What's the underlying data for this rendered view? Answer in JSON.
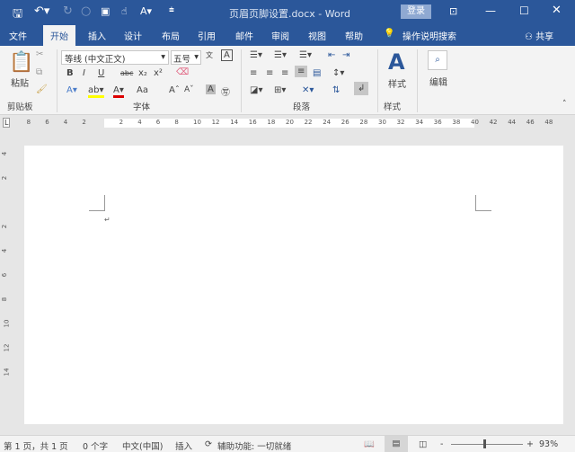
{
  "title_bar": {
    "document_title": "页眉页脚设置.docx - Word",
    "login_label": "登录"
  },
  "tabs": [
    {
      "label": "文件"
    },
    {
      "label": "开始"
    },
    {
      "label": "插入"
    },
    {
      "label": "设计"
    },
    {
      "label": "布局"
    },
    {
      "label": "引用"
    },
    {
      "label": "邮件"
    },
    {
      "label": "审阅"
    },
    {
      "label": "视图"
    },
    {
      "label": "帮助"
    }
  ],
  "tell_me": "操作说明搜索",
  "share": "共享",
  "ribbon": {
    "clipboard": {
      "paste": "粘贴",
      "group": "剪贴板"
    },
    "font": {
      "name": "等线 (中文正文)",
      "size": "五号",
      "group": "字体",
      "bold": "B",
      "italic": "I",
      "underline": "U",
      "strike": "abc",
      "sub": "x₂",
      "sup": "x²",
      "case": "Aa"
    },
    "paragraph": {
      "group": "段落"
    },
    "styles": {
      "label": "样式",
      "group": "样式"
    },
    "editing": {
      "label": "编辑"
    }
  },
  "ruler": {
    "ticks": [
      "8",
      "6",
      "4",
      "2",
      "2",
      "4",
      "6",
      "8",
      "10",
      "12",
      "14",
      "16",
      "18",
      "20",
      "22",
      "24",
      "26",
      "28",
      "30",
      "32",
      "34",
      "36",
      "38",
      "40",
      "42",
      "44",
      "46",
      "48"
    ],
    "vticks": [
      "4",
      "2",
      "2",
      "4",
      "6",
      "8",
      "10",
      "12",
      "14"
    ]
  },
  "status": {
    "page": "第 1 页，共 1 页",
    "words": "0 个字",
    "lang": "中文(中国)",
    "mode": "插入",
    "accessibility": "辅助功能: 一切就绪",
    "zoom": "93%",
    "zoom_fraction": 0.45
  }
}
